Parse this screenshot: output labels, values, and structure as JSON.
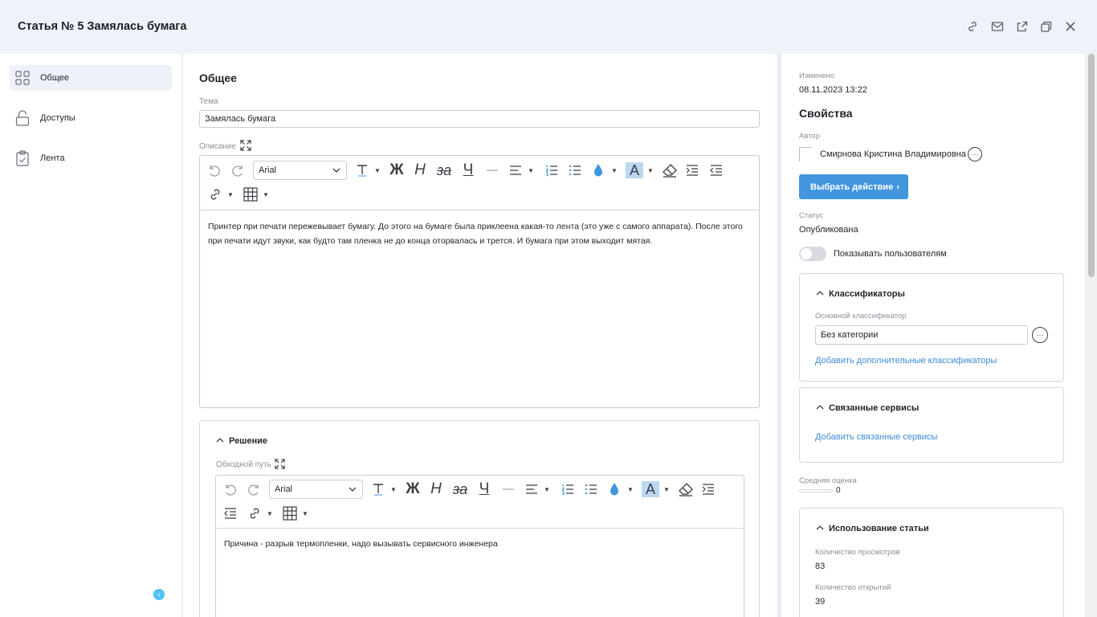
{
  "header": {
    "title": "Статья № 5 Замялась бумага"
  },
  "sidebar": {
    "items": [
      {
        "label": "Общее",
        "icon": "grid-icon"
      },
      {
        "label": "Доступы",
        "icon": "lock-icon"
      },
      {
        "label": "Лента",
        "icon": "clipboard-icon"
      }
    ]
  },
  "main": {
    "section_title": "Общее",
    "topic": {
      "label": "Тема",
      "value": "Замялась бумага"
    },
    "description": {
      "label": "Описание",
      "font": "Arial",
      "text": "Принтер при печати пережевывает бумагу. До этого на бумаге была приклеена какая-то лента (это уже с самого аппарата). После этого при печати идут звуки, как будто там пленка не до конца оторвалась и трется. И бумага при этом выходит мятая."
    },
    "solution": {
      "title": "Решение",
      "workaround_label": "Обходной путь",
      "font": "Arial",
      "text": "Причина - разрыв термопленки, надо вызывать сервисного инженера"
    },
    "toolbar": {
      "bold": "Ж",
      "italic": "Н",
      "strike": "за",
      "underline": "Ч",
      "text_color_glyph": "A"
    }
  },
  "right": {
    "modified_label": "Изменено",
    "modified_value": "08.11.2023 13:22",
    "properties_title": "Свойства",
    "author_label": "Автор",
    "author_name": "Смирнова Кристина Владимировна",
    "action_button": "Выбрать действие",
    "status_label": "Статус",
    "status_value": "Опубликована",
    "show_users_label": "Показывать пользователям",
    "show_users_on": false,
    "classifiers": {
      "title": "Классификаторы",
      "main_label": "Основной классификатор",
      "main_value": "Без категории",
      "add_link": "Добавить дополнительные классификаторы"
    },
    "services": {
      "title": "Связанные сервисы",
      "add_link": "Добавить связанные сервисы"
    },
    "rating": {
      "label": "Средняя оценка",
      "value": "0"
    },
    "usage": {
      "title": "Использование статьи",
      "views_label": "Количество просмотров",
      "views_value": "83",
      "opens_label": "Количество открытий",
      "opens_value": "39"
    }
  },
  "colors": {
    "accent": "#4296de",
    "link": "#3d8bd8",
    "collapse": "#4dc3f7"
  }
}
